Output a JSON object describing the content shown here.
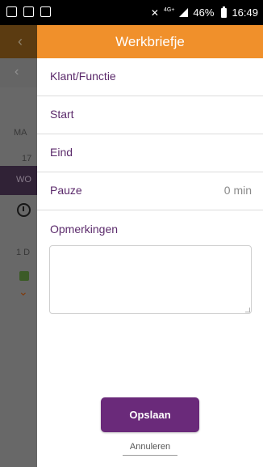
{
  "statusbar": {
    "network": "4G+",
    "battery": "46%",
    "time": "16:49"
  },
  "dialog": {
    "title": "Werkbriefje",
    "fields": [
      {
        "label": "Klant/Functie",
        "value": ""
      },
      {
        "label": "Start",
        "value": ""
      },
      {
        "label": "Eind",
        "value": ""
      },
      {
        "label": "Pauze",
        "value": "0 min"
      }
    ],
    "notes_label": "Opmerkingen",
    "notes_value": "",
    "save_label": "Opslaan",
    "cancel_label": "Annuleren"
  },
  "background": {
    "visible_fragments": [
      "MA",
      "17",
      "WO",
      "1 D"
    ]
  },
  "colors": {
    "header": "#f0902b",
    "primary": "#6a2a7a",
    "label": "#5b2a6b"
  }
}
